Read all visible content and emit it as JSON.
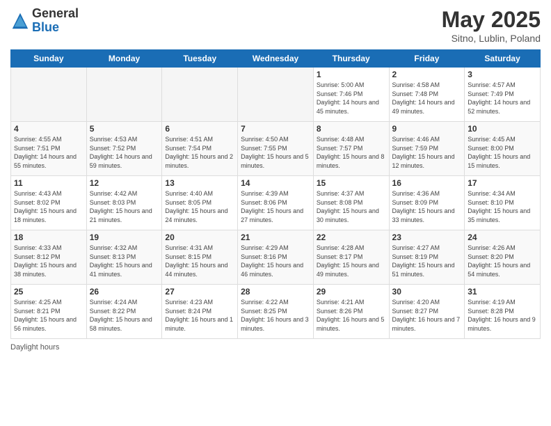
{
  "logo": {
    "general": "General",
    "blue": "Blue"
  },
  "title": "May 2025",
  "location": "Sitno, Lublin, Poland",
  "days_of_week": [
    "Sunday",
    "Monday",
    "Tuesday",
    "Wednesday",
    "Thursday",
    "Friday",
    "Saturday"
  ],
  "footer": "Daylight hours",
  "weeks": [
    [
      {
        "day": "",
        "empty": true
      },
      {
        "day": "",
        "empty": true
      },
      {
        "day": "",
        "empty": true
      },
      {
        "day": "",
        "empty": true
      },
      {
        "day": "1",
        "sunrise": "5:00 AM",
        "sunset": "7:46 PM",
        "daylight": "14 hours and 45 minutes."
      },
      {
        "day": "2",
        "sunrise": "4:58 AM",
        "sunset": "7:48 PM",
        "daylight": "14 hours and 49 minutes."
      },
      {
        "day": "3",
        "sunrise": "4:57 AM",
        "sunset": "7:49 PM",
        "daylight": "14 hours and 52 minutes."
      }
    ],
    [
      {
        "day": "4",
        "sunrise": "4:55 AM",
        "sunset": "7:51 PM",
        "daylight": "14 hours and 55 minutes."
      },
      {
        "day": "5",
        "sunrise": "4:53 AM",
        "sunset": "7:52 PM",
        "daylight": "14 hours and 59 minutes."
      },
      {
        "day": "6",
        "sunrise": "4:51 AM",
        "sunset": "7:54 PM",
        "daylight": "15 hours and 2 minutes."
      },
      {
        "day": "7",
        "sunrise": "4:50 AM",
        "sunset": "7:55 PM",
        "daylight": "15 hours and 5 minutes."
      },
      {
        "day": "8",
        "sunrise": "4:48 AM",
        "sunset": "7:57 PM",
        "daylight": "15 hours and 8 minutes."
      },
      {
        "day": "9",
        "sunrise": "4:46 AM",
        "sunset": "7:59 PM",
        "daylight": "15 hours and 12 minutes."
      },
      {
        "day": "10",
        "sunrise": "4:45 AM",
        "sunset": "8:00 PM",
        "daylight": "15 hours and 15 minutes."
      }
    ],
    [
      {
        "day": "11",
        "sunrise": "4:43 AM",
        "sunset": "8:02 PM",
        "daylight": "15 hours and 18 minutes."
      },
      {
        "day": "12",
        "sunrise": "4:42 AM",
        "sunset": "8:03 PM",
        "daylight": "15 hours and 21 minutes."
      },
      {
        "day": "13",
        "sunrise": "4:40 AM",
        "sunset": "8:05 PM",
        "daylight": "15 hours and 24 minutes."
      },
      {
        "day": "14",
        "sunrise": "4:39 AM",
        "sunset": "8:06 PM",
        "daylight": "15 hours and 27 minutes."
      },
      {
        "day": "15",
        "sunrise": "4:37 AM",
        "sunset": "8:08 PM",
        "daylight": "15 hours and 30 minutes."
      },
      {
        "day": "16",
        "sunrise": "4:36 AM",
        "sunset": "8:09 PM",
        "daylight": "15 hours and 33 minutes."
      },
      {
        "day": "17",
        "sunrise": "4:34 AM",
        "sunset": "8:10 PM",
        "daylight": "15 hours and 35 minutes."
      }
    ],
    [
      {
        "day": "18",
        "sunrise": "4:33 AM",
        "sunset": "8:12 PM",
        "daylight": "15 hours and 38 minutes."
      },
      {
        "day": "19",
        "sunrise": "4:32 AM",
        "sunset": "8:13 PM",
        "daylight": "15 hours and 41 minutes."
      },
      {
        "day": "20",
        "sunrise": "4:31 AM",
        "sunset": "8:15 PM",
        "daylight": "15 hours and 44 minutes."
      },
      {
        "day": "21",
        "sunrise": "4:29 AM",
        "sunset": "8:16 PM",
        "daylight": "15 hours and 46 minutes."
      },
      {
        "day": "22",
        "sunrise": "4:28 AM",
        "sunset": "8:17 PM",
        "daylight": "15 hours and 49 minutes."
      },
      {
        "day": "23",
        "sunrise": "4:27 AM",
        "sunset": "8:19 PM",
        "daylight": "15 hours and 51 minutes."
      },
      {
        "day": "24",
        "sunrise": "4:26 AM",
        "sunset": "8:20 PM",
        "daylight": "15 hours and 54 minutes."
      }
    ],
    [
      {
        "day": "25",
        "sunrise": "4:25 AM",
        "sunset": "8:21 PM",
        "daylight": "15 hours and 56 minutes."
      },
      {
        "day": "26",
        "sunrise": "4:24 AM",
        "sunset": "8:22 PM",
        "daylight": "15 hours and 58 minutes."
      },
      {
        "day": "27",
        "sunrise": "4:23 AM",
        "sunset": "8:24 PM",
        "daylight": "16 hours and 1 minute."
      },
      {
        "day": "28",
        "sunrise": "4:22 AM",
        "sunset": "8:25 PM",
        "daylight": "16 hours and 3 minutes."
      },
      {
        "day": "29",
        "sunrise": "4:21 AM",
        "sunset": "8:26 PM",
        "daylight": "16 hours and 5 minutes."
      },
      {
        "day": "30",
        "sunrise": "4:20 AM",
        "sunset": "8:27 PM",
        "daylight": "16 hours and 7 minutes."
      },
      {
        "day": "31",
        "sunrise": "4:19 AM",
        "sunset": "8:28 PM",
        "daylight": "16 hours and 9 minutes."
      }
    ]
  ]
}
